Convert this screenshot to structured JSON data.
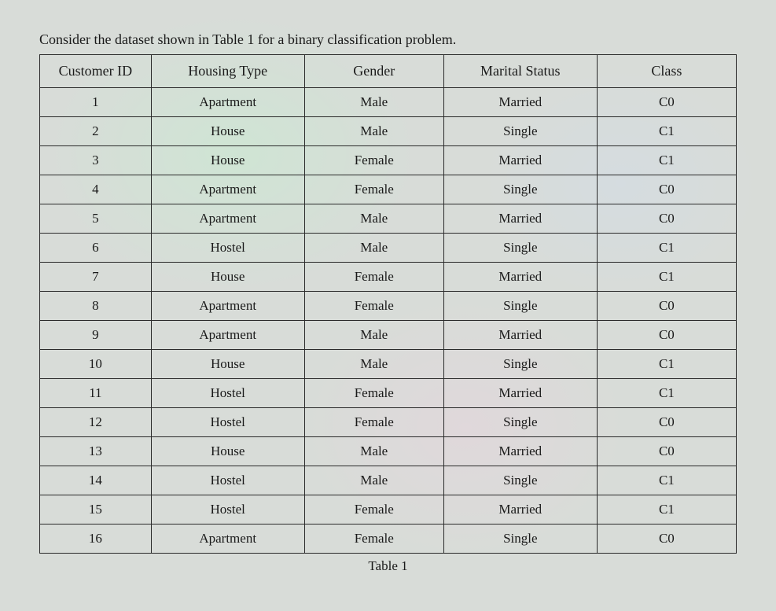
{
  "intro": "Consider the dataset shown in Table 1 for a binary classification problem.",
  "caption": "Table 1",
  "headers": {
    "customer_id": "Customer ID",
    "housing_type": "Housing Type",
    "gender": "Gender",
    "marital_status": "Marital Status",
    "class": "Class"
  },
  "rows": [
    {
      "id": "1",
      "housing": "Apartment",
      "gender": "Male",
      "marital": "Married",
      "class": "C0"
    },
    {
      "id": "2",
      "housing": "House",
      "gender": "Male",
      "marital": "Single",
      "class": "C1"
    },
    {
      "id": "3",
      "housing": "House",
      "gender": "Female",
      "marital": "Married",
      "class": "C1"
    },
    {
      "id": "4",
      "housing": "Apartment",
      "gender": "Female",
      "marital": "Single",
      "class": "C0"
    },
    {
      "id": "5",
      "housing": "Apartment",
      "gender": "Male",
      "marital": "Married",
      "class": "C0"
    },
    {
      "id": "6",
      "housing": "Hostel",
      "gender": "Male",
      "marital": "Single",
      "class": "C1"
    },
    {
      "id": "7",
      "housing": "House",
      "gender": "Female",
      "marital": "Married",
      "class": "C1"
    },
    {
      "id": "8",
      "housing": "Apartment",
      "gender": "Female",
      "marital": "Single",
      "class": "C0"
    },
    {
      "id": "9",
      "housing": "Apartment",
      "gender": "Male",
      "marital": "Married",
      "class": "C0"
    },
    {
      "id": "10",
      "housing": "House",
      "gender": "Male",
      "marital": "Single",
      "class": "C1"
    },
    {
      "id": "11",
      "housing": "Hostel",
      "gender": "Female",
      "marital": "Married",
      "class": "C1"
    },
    {
      "id": "12",
      "housing": "Hostel",
      "gender": "Female",
      "marital": "Single",
      "class": "C0"
    },
    {
      "id": "13",
      "housing": "House",
      "gender": "Male",
      "marital": "Married",
      "class": "C0"
    },
    {
      "id": "14",
      "housing": "Hostel",
      "gender": "Male",
      "marital": "Single",
      "class": "C1"
    },
    {
      "id": "15",
      "housing": "Hostel",
      "gender": "Female",
      "marital": "Married",
      "class": "C1"
    },
    {
      "id": "16",
      "housing": "Apartment",
      "gender": "Female",
      "marital": "Single",
      "class": "C0"
    }
  ]
}
